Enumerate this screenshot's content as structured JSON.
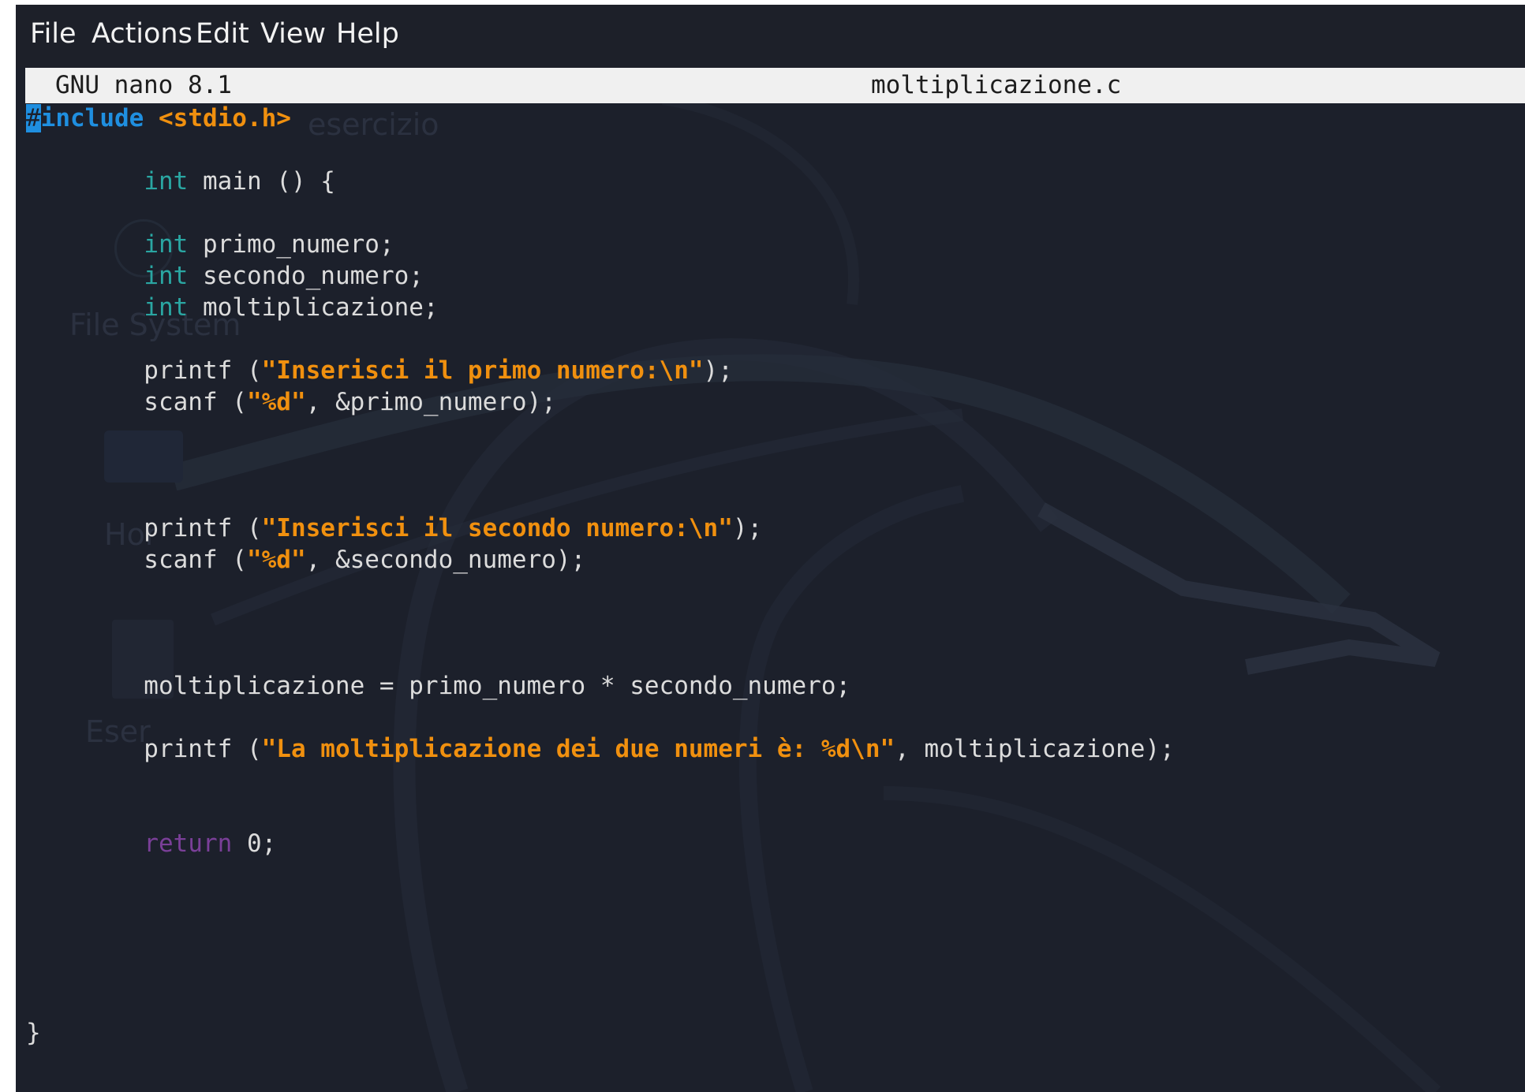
{
  "menubar": {
    "items": [
      "File",
      "Actions",
      "Edit",
      "View",
      "Help"
    ]
  },
  "nano": {
    "version": "GNU nano 8.1",
    "filename": "moltiplicazione.c"
  },
  "desktop_ghost": {
    "labels": [
      "esercizio",
      "File System",
      "Hor",
      "Eser"
    ]
  },
  "code": {
    "l01": {
      "cursor": "#",
      "a": "include",
      "b": " <stdio.h>"
    },
    "l03": {
      "indent": "        ",
      "type": "int",
      "rest": " main () {"
    },
    "l05": {
      "indent": "        ",
      "type": "int",
      "rest": " primo_numero;"
    },
    "l06": {
      "indent": "        ",
      "type": "int",
      "rest": " secondo_numero;"
    },
    "l07": {
      "indent": "        ",
      "type": "int",
      "rest": " moltiplicazione;"
    },
    "l09": {
      "pre": "        printf (",
      "str": "\"Inserisci il primo numero:\\n\"",
      "post": ");"
    },
    "l10": {
      "pre": "        scanf (",
      "str": "\"%d\"",
      "post": ", &primo_numero);"
    },
    "l14": {
      "pre": "        printf (",
      "str": "\"Inserisci il secondo numero:\\n\"",
      "post": ");"
    },
    "l15": {
      "pre": "        scanf (",
      "str": "\"%d\"",
      "post": ", &secondo_numero);"
    },
    "l19": {
      "text": "        moltiplicazione = primo_numero * secondo_numero;"
    },
    "l21": {
      "pre": "        printf (",
      "str": "\"La moltiplicazione dei due numeri è: %d\\n\"",
      "post": ", moltiplicazione);"
    },
    "l24": {
      "indent": "        ",
      "kw": "return",
      "rest": " 0;"
    },
    "l30": {
      "text": "}"
    }
  }
}
